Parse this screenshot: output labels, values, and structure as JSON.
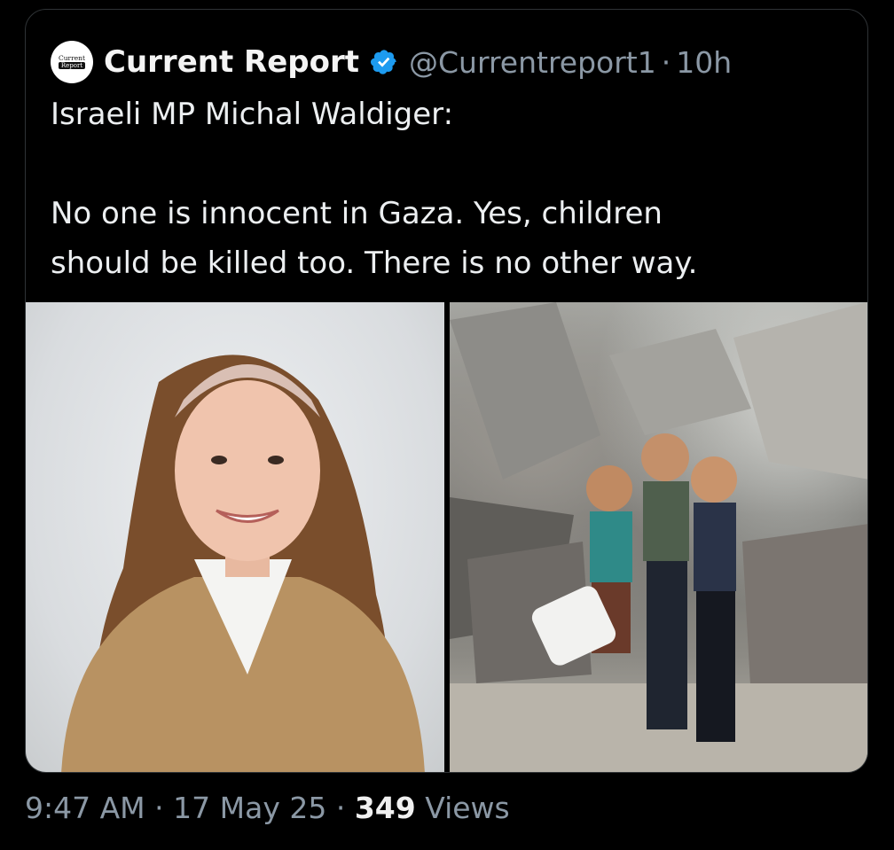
{
  "post": {
    "author": {
      "avatar_text_1": "Current",
      "avatar_text_2": "Report",
      "name": "Current Report",
      "handle": "@Currentreport1",
      "separator": "·",
      "age": "10h"
    },
    "text": "Israeli MP Michal Waldiger:\n\nNo one is innocent in Gaza. Yes, children\nshould be killed too. There is no other way.",
    "media": [
      {
        "alt": "photo-portrait"
      },
      {
        "alt": "photo-children-in-rubble"
      }
    ]
  },
  "footer": {
    "time": "9:47 AM",
    "sep1": "·",
    "date": "17 May 25",
    "sep2": "·",
    "views_count": "349",
    "views_label": "Views"
  },
  "colors": {
    "background": "#000000",
    "text": "#e7e9ea",
    "muted": "#8b98a5",
    "verified": "#1d9bf0"
  }
}
